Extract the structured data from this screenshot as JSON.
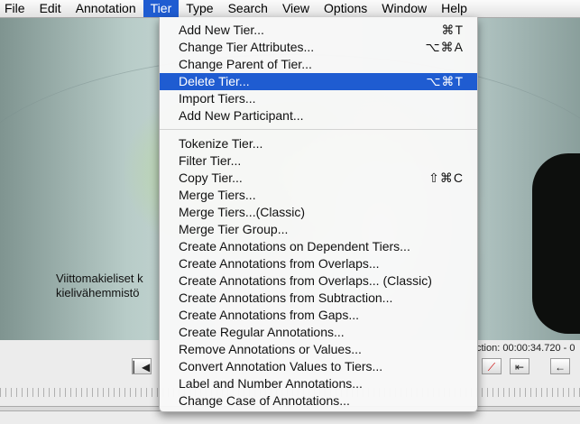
{
  "menubar": {
    "items": [
      {
        "label": "File",
        "active": false
      },
      {
        "label": "Edit",
        "active": false
      },
      {
        "label": "Annotation",
        "active": false
      },
      {
        "label": "Tier",
        "active": true
      },
      {
        "label": "Type",
        "active": false
      },
      {
        "label": "Search",
        "active": false
      },
      {
        "label": "View",
        "active": false
      },
      {
        "label": "Options",
        "active": false
      },
      {
        "label": "Window",
        "active": false
      },
      {
        "label": "Help",
        "active": false
      }
    ]
  },
  "video": {
    "subtitle_line1": "Viittomakieliset k",
    "subtitle_line2": "kielivähemmistö"
  },
  "selection_label": "ction: 00:00:34.720 - 0",
  "tier_menu": {
    "group1": [
      {
        "label": "Add New Tier...",
        "shortcut": "⌘T"
      },
      {
        "label": "Change Tier Attributes...",
        "shortcut": "⌥⌘A"
      },
      {
        "label": "Change Parent of Tier...",
        "shortcut": ""
      },
      {
        "label": "Delete Tier...",
        "shortcut": "⌥⌘T"
      },
      {
        "label": "Import Tiers...",
        "shortcut": ""
      },
      {
        "label": "Add New Participant...",
        "shortcut": ""
      }
    ],
    "group2": [
      {
        "label": "Tokenize Tier...",
        "shortcut": ""
      },
      {
        "label": "Filter Tier...",
        "shortcut": ""
      },
      {
        "label": "Copy Tier...",
        "shortcut": "⇧⌘C"
      },
      {
        "label": "Merge Tiers...",
        "shortcut": ""
      },
      {
        "label": "Merge Tiers...(Classic)",
        "shortcut": ""
      },
      {
        "label": "Merge Tier Group...",
        "shortcut": ""
      },
      {
        "label": "Create Annotations on Dependent Tiers...",
        "shortcut": ""
      },
      {
        "label": "Create Annotations from Overlaps...",
        "shortcut": ""
      },
      {
        "label": "Create Annotations from Overlaps... (Classic)",
        "shortcut": ""
      },
      {
        "label": "Create Annotations from Subtraction...",
        "shortcut": ""
      },
      {
        "label": "Create Annotations from Gaps...",
        "shortcut": ""
      },
      {
        "label": "Create Regular Annotations...",
        "shortcut": ""
      },
      {
        "label": "Remove Annotations or Values...",
        "shortcut": ""
      },
      {
        "label": "Convert Annotation Values to Tiers...",
        "shortcut": ""
      },
      {
        "label": "Label and Number Annotations...",
        "shortcut": ""
      },
      {
        "label": "Change Case of Annotations...",
        "shortcut": ""
      }
    ],
    "highlighted": "Delete Tier..."
  },
  "toolbar_buttons": [
    {
      "icon": "go-to-begin-icon",
      "glyph": "⏮"
    },
    {
      "icon": "no-selection-icon",
      "glyph": "⟋"
    },
    {
      "icon": "go-to-selection-begin-icon",
      "glyph": "⇤"
    },
    {
      "icon": "step-back-icon",
      "glyph": "←"
    }
  ]
}
